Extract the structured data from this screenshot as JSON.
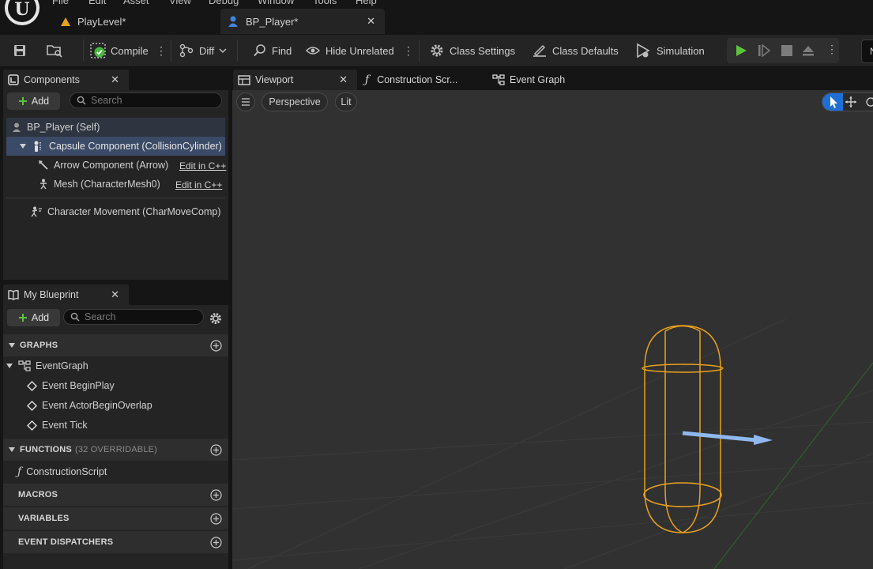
{
  "menu": [
    "File",
    "Edit",
    "Asset",
    "View",
    "Debug",
    "Window",
    "Tools",
    "Help"
  ],
  "doc_tabs": [
    {
      "label": "PlayLevel*",
      "icon": "level-icon"
    },
    {
      "label": "BP_Player*",
      "icon": "blueprint-actor-icon"
    }
  ],
  "toolbar": {
    "compile": "Compile",
    "diff": "Diff",
    "find": "Find",
    "hide_unrelated": "Hide Unrelated",
    "class_settings": "Class Settings",
    "class_defaults": "Class Defaults",
    "simulation": "Simulation",
    "right_btn": "N"
  },
  "components": {
    "tab": "Components",
    "add": "Add",
    "search_placeholder": "Search",
    "tree": {
      "root": "BP_Player (Self)",
      "capsule": "Capsule Component (CollisionCylinder)",
      "arrow": "Arrow Component (Arrow)",
      "mesh": "Mesh (CharacterMesh0)",
      "movement": "Character Movement (CharMoveComp)",
      "edit_cpp": "Edit in C++"
    }
  },
  "my_blueprint": {
    "tab": "My Blueprint",
    "add": "Add",
    "search_placeholder": "Search",
    "graphs_header": "GRAPHS",
    "event_graph": "EventGraph",
    "events": [
      "Event BeginPlay",
      "Event ActorBeginOverlap",
      "Event Tick"
    ],
    "functions_header": "FUNCTIONS",
    "functions_note": "(32 OVERRIDABLE)",
    "construction_script": "ConstructionScript",
    "macros_header": "MACROS",
    "variables_header": "VARIABLES",
    "dispatchers_header": "EVENT DISPATCHERS"
  },
  "editor_tabs": [
    "Viewport",
    "Construction Scr...",
    "Event Graph"
  ],
  "viewport": {
    "perspective": "Perspective",
    "lit": "Lit"
  },
  "colors": {
    "accent_blue": "#1f6fd6",
    "play_green": "#5ec33c",
    "capsule_orange": "#e8a11e",
    "arrow_blue": "#8fb8ee",
    "compile_check": "#46b83c"
  }
}
